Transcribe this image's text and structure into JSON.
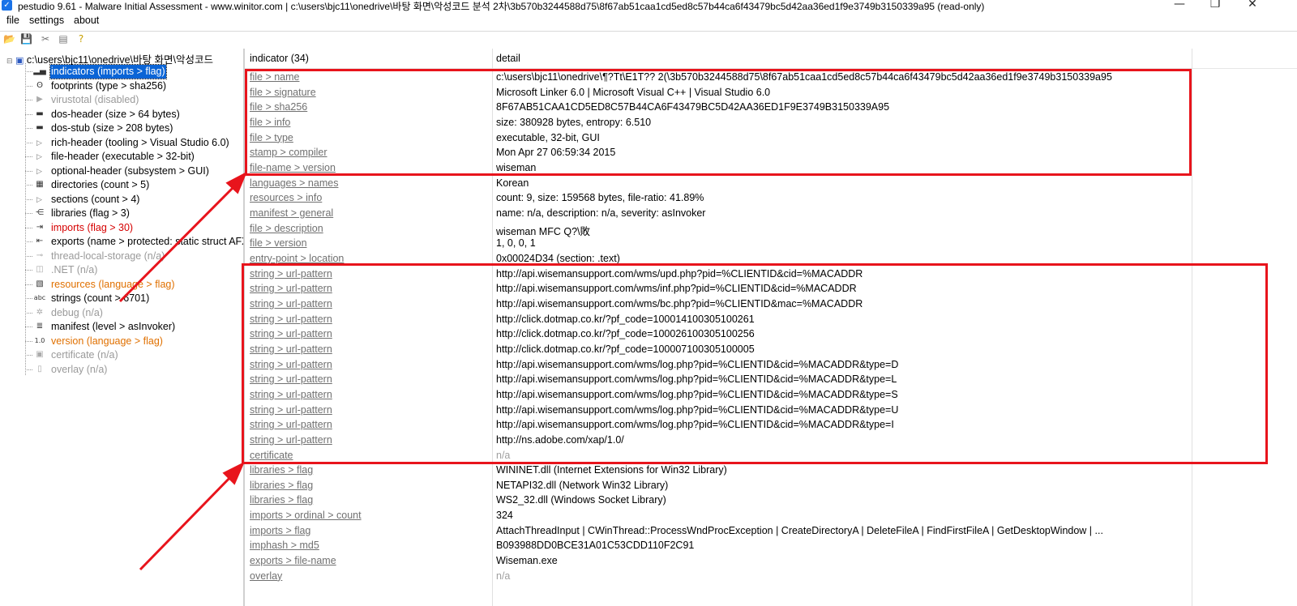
{
  "window": {
    "title": "pestudio 9.61 - Malware Initial Assessment - www.winitor.com | c:\\users\\bjc11\\onedrive\\바탕 화면\\악성코드 분석 2차\\3b570b3244588d75\\8f67ab51caa1cd5ed8c57b44ca6f43479bc5d42aa36ed1f9e3749b3150339a95 (read-only)",
    "minimize": "—",
    "maximize": "❐",
    "close": "✕"
  },
  "menu": {
    "file": "file",
    "settings": "settings",
    "about": "about"
  },
  "toolbar": {
    "open_icon": "folder-open-icon",
    "save_icon": "save-icon",
    "cut_icon": "cut-icon",
    "list_icon": "list-icon",
    "help_icon": "help-icon"
  },
  "tree": {
    "root_label": "c:\\users\\bjc11\\onedrive\\바탕 화면\\악성코드",
    "items": [
      {
        "label": "indicators (imports > flag)",
        "icon": "bar-chart-icon",
        "style": "selected"
      },
      {
        "label": "footprints (type > sha256)",
        "icon": "footprint-icon",
        "style": "normal"
      },
      {
        "label": "virustotal (disabled)",
        "icon": "virustotal-icon",
        "style": "disabled"
      },
      {
        "label": "dos-header (size > 64 bytes)",
        "icon": "console-icon",
        "style": "normal"
      },
      {
        "label": "dos-stub (size > 208 bytes)",
        "icon": "console-icon",
        "style": "normal"
      },
      {
        "label": "rich-header (tooling > Visual Studio 6.0)",
        "icon": "expand-icon",
        "style": "normal"
      },
      {
        "label": "file-header (executable > 32-bit)",
        "icon": "expand-icon",
        "style": "normal"
      },
      {
        "label": "optional-header (subsystem > GUI)",
        "icon": "expand-icon",
        "style": "normal"
      },
      {
        "label": "directories (count > 5)",
        "icon": "directories-icon",
        "style": "normal"
      },
      {
        "label": "sections (count > 4)",
        "icon": "expand-icon",
        "style": "normal"
      },
      {
        "label": "libraries (flag > 3)",
        "icon": "libraries-icon",
        "style": "normal"
      },
      {
        "label": "imports (flag > 30)",
        "icon": "imports-icon",
        "style": "red"
      },
      {
        "label": "exports (name > protected: static struct AFX",
        "icon": "exports-icon",
        "style": "normal"
      },
      {
        "label": "thread-local-storage (n/a)",
        "icon": "tls-icon",
        "style": "disabled"
      },
      {
        "label": ".NET (n/a)",
        "icon": "dotnet-icon",
        "style": "disabled"
      },
      {
        "label": "resources (language > flag)",
        "icon": "resources-icon",
        "style": "orange"
      },
      {
        "label": "strings (count > 6701)",
        "icon": "abc-icon",
        "style": "normal"
      },
      {
        "label": "debug (n/a)",
        "icon": "bug-icon",
        "style": "disabled"
      },
      {
        "label": "manifest (level > asInvoker)",
        "icon": "manifest-icon",
        "style": "normal"
      },
      {
        "label": "version (language > flag)",
        "icon": "version-icon",
        "style": "orange"
      },
      {
        "label": "certificate (n/a)",
        "icon": "certificate-icon",
        "style": "disabled"
      },
      {
        "label": "overlay (n/a)",
        "icon": "page-icon",
        "style": "disabled"
      }
    ]
  },
  "grid": {
    "header_indicator": "indicator (34)",
    "header_detail": "detail",
    "rows": [
      {
        "indicator": "file > name",
        "detail": "c:\\users\\bjc11\\onedrive\\¶?Tt\\E1T?? 2(\\3b570b3244588d75\\8f67ab51caa1cd5ed8c57b44ca6f43479bc5d42aa36ed1f9e3749b3150339a95"
      },
      {
        "indicator": "file > signature",
        "detail": "Microsoft Linker 6.0 | Microsoft Visual C++ | Visual Studio 6.0"
      },
      {
        "indicator": "file > sha256",
        "detail": "8F67AB51CAA1CD5ED8C57B44CA6F43479BC5D42AA36ED1F9E3749B3150339A95"
      },
      {
        "indicator": "file > info",
        "detail": "size: 380928 bytes, entropy: 6.510"
      },
      {
        "indicator": "file > type",
        "detail": "executable, 32-bit, GUI"
      },
      {
        "indicator": "stamp > compiler",
        "detail": "Mon Apr 27 06:59:34 2015"
      },
      {
        "indicator": "file-name > version",
        "detail": "wiseman"
      },
      {
        "indicator": "languages > names",
        "detail": "Korean"
      },
      {
        "indicator": "resources > info",
        "detail": "count: 9, size: 159568 bytes, file-ratio: 41.89%"
      },
      {
        "indicator": "manifest > general",
        "detail": "name: n/a, description: n/a, severity: asInvoker"
      },
      {
        "indicator": "file > description",
        "detail": "wiseman MFC Q?\\敗"
      },
      {
        "indicator": "file > version",
        "detail": "1, 0, 0, 1"
      },
      {
        "indicator": "entry-point > location",
        "detail": "0x00024D34 (section: .text)"
      },
      {
        "indicator": "string > url-pattern",
        "detail": "http://api.wisemansupport.com/wms/upd.php?pid=%CLIENTID&cid=%MACADDR"
      },
      {
        "indicator": "string > url-pattern",
        "detail": "http://api.wisemansupport.com/wms/inf.php?pid=%CLIENTID&cid=%MACADDR"
      },
      {
        "indicator": "string > url-pattern",
        "detail": "http://api.wisemansupport.com/wms/bc.php?pid=%CLIENTID&mac=%MACADDR"
      },
      {
        "indicator": "string > url-pattern",
        "detail": "http://click.dotmap.co.kr/?pf_code=100014100305100261"
      },
      {
        "indicator": "string > url-pattern",
        "detail": "http://click.dotmap.co.kr/?pf_code=100026100305100256"
      },
      {
        "indicator": "string > url-pattern",
        "detail": "http://click.dotmap.co.kr/?pf_code=100007100305100005"
      },
      {
        "indicator": "string > url-pattern",
        "detail": "http://api.wisemansupport.com/wms/log.php?pid=%CLIENTID&cid=%MACADDR&type=D"
      },
      {
        "indicator": "string > url-pattern",
        "detail": "http://api.wisemansupport.com/wms/log.php?pid=%CLIENTID&cid=%MACADDR&type=L"
      },
      {
        "indicator": "string > url-pattern",
        "detail": "http://api.wisemansupport.com/wms/log.php?pid=%CLIENTID&cid=%MACADDR&type=S"
      },
      {
        "indicator": "string > url-pattern",
        "detail": "http://api.wisemansupport.com/wms/log.php?pid=%CLIENTID&cid=%MACADDR&type=U"
      },
      {
        "indicator": "string > url-pattern",
        "detail": "http://api.wisemansupport.com/wms/log.php?pid=%CLIENTID&cid=%MACADDR&type=I"
      },
      {
        "indicator": "string > url-pattern",
        "detail": "http://ns.adobe.com/xap/1.0/"
      },
      {
        "indicator": "certificate",
        "detail": "n/a",
        "na": true
      },
      {
        "indicator": "libraries > flag",
        "detail": "WININET.dll (Internet Extensions for Win32 Library)"
      },
      {
        "indicator": "libraries > flag",
        "detail": "NETAPI32.dll (Network Win32 Library)"
      },
      {
        "indicator": "libraries > flag",
        "detail": "WS2_32.dll (Windows Socket Library)"
      },
      {
        "indicator": "imports > ordinal > count",
        "detail": "324"
      },
      {
        "indicator": "imports > flag",
        "detail": "AttachThreadInput | CWinThread::ProcessWndProcException | CreateDirectoryA | DeleteFileA | FindFirstFileA | GetDesktopWindow | ..."
      },
      {
        "indicator": "imphash > md5",
        "detail": "B093988DD0BCE31A01C53CDD110F2C91"
      },
      {
        "indicator": "exports > file-name",
        "detail": "Wiseman.exe"
      },
      {
        "indicator": "overlay",
        "detail": "n/a",
        "na": true
      }
    ]
  },
  "annotations": {
    "highlight_color": "#e8141c"
  }
}
